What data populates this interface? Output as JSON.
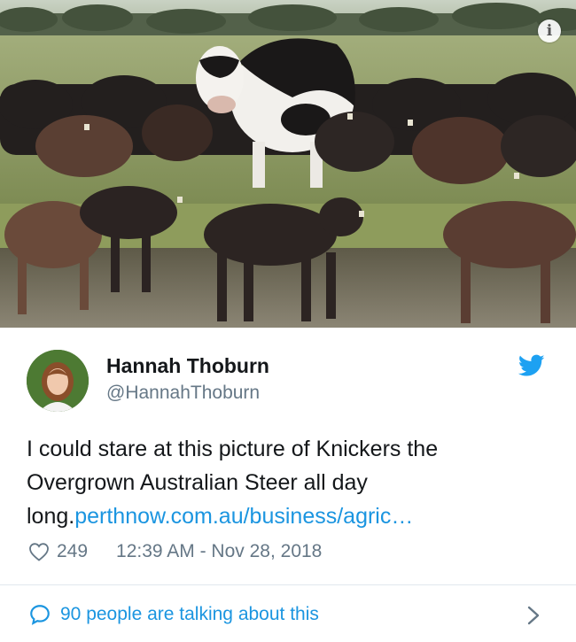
{
  "photo": {
    "alt_subject": "cow-herd-photo",
    "info_glyph": "i"
  },
  "tweet": {
    "author_name": "Hannah Thoburn",
    "author_handle": "@HannahThoburn",
    "text_plain": "I could stare at this picture of Knickers the Overgrown Australian Steer all day long.",
    "link_text": "perthnow.com.au/business/agric…",
    "likes": "249",
    "timestamp": "12:39 AM - Nov 28, 2018",
    "conversation_label": "90 people are talking about this"
  },
  "colors": {
    "text": "#14171a",
    "secondary": "#657786",
    "link": "#1b95e0",
    "twitter_blue": "#1da1f2",
    "divider": "#e1e8ed"
  },
  "icons": {
    "brand": "twitter-bird-icon",
    "like": "heart-outline-icon",
    "conversation": "speech-bubble-icon",
    "chevron": "chevron-right-icon",
    "info": "info-icon"
  }
}
